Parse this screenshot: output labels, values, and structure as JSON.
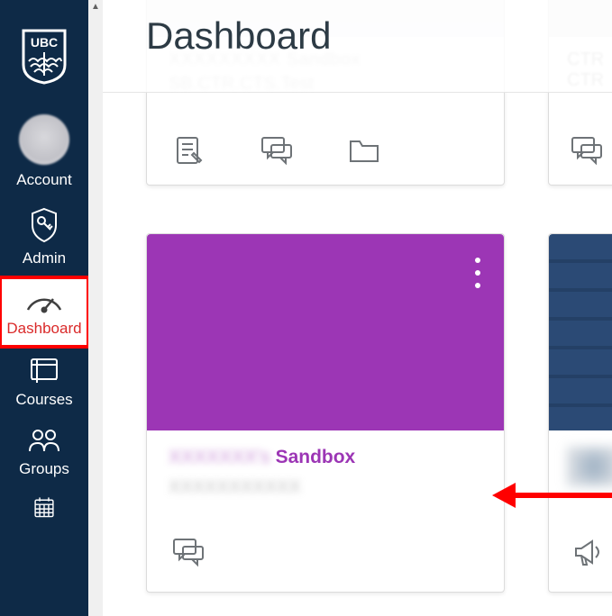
{
  "sidebar": {
    "logo_label": "UBC",
    "items": [
      {
        "id": "account",
        "label": "Account"
      },
      {
        "id": "admin",
        "label": "Admin"
      },
      {
        "id": "dashboard",
        "label": "Dashboard"
      },
      {
        "id": "courses",
        "label": "Courses"
      },
      {
        "id": "groups",
        "label": "Groups"
      },
      {
        "id": "calendar",
        "label": "Calendar"
      }
    ],
    "active_item_id": "dashboard"
  },
  "header": {
    "title": "Dashboard"
  },
  "cards": [
    {
      "id": "card1",
      "title_blurred": "XXXXXXXXX Sandbox",
      "subtitle_blurred": "SB.CTR.CTS.Test",
      "color": "#e6e6ea",
      "actions": [
        "assignments",
        "discussions",
        "files"
      ]
    },
    {
      "id": "card_peek1",
      "title_blurred": "CTR",
      "subtitle_blurred": "CTR",
      "color": "#e6e6ea",
      "actions": [
        "discussions"
      ]
    },
    {
      "id": "card2",
      "title_blurred_prefix": "XXXXXXX's",
      "title_suffix": "Sandbox",
      "subtitle_blurred": "XXXXXXXXXXX",
      "color": "#9c36b5",
      "actions": [
        "discussions"
      ]
    },
    {
      "id": "card_peek2",
      "color": "#2b4a75",
      "actions": [
        "announcements"
      ]
    }
  ],
  "annotations": {
    "dashboard_highlight": true,
    "arrow_points_to": "card2"
  },
  "colors": {
    "sidebar_bg": "#0e2a47",
    "highlight_border": "#ff0000",
    "card2_accent": "#9c36b5",
    "card_peek2_accent": "#2b4a75"
  }
}
